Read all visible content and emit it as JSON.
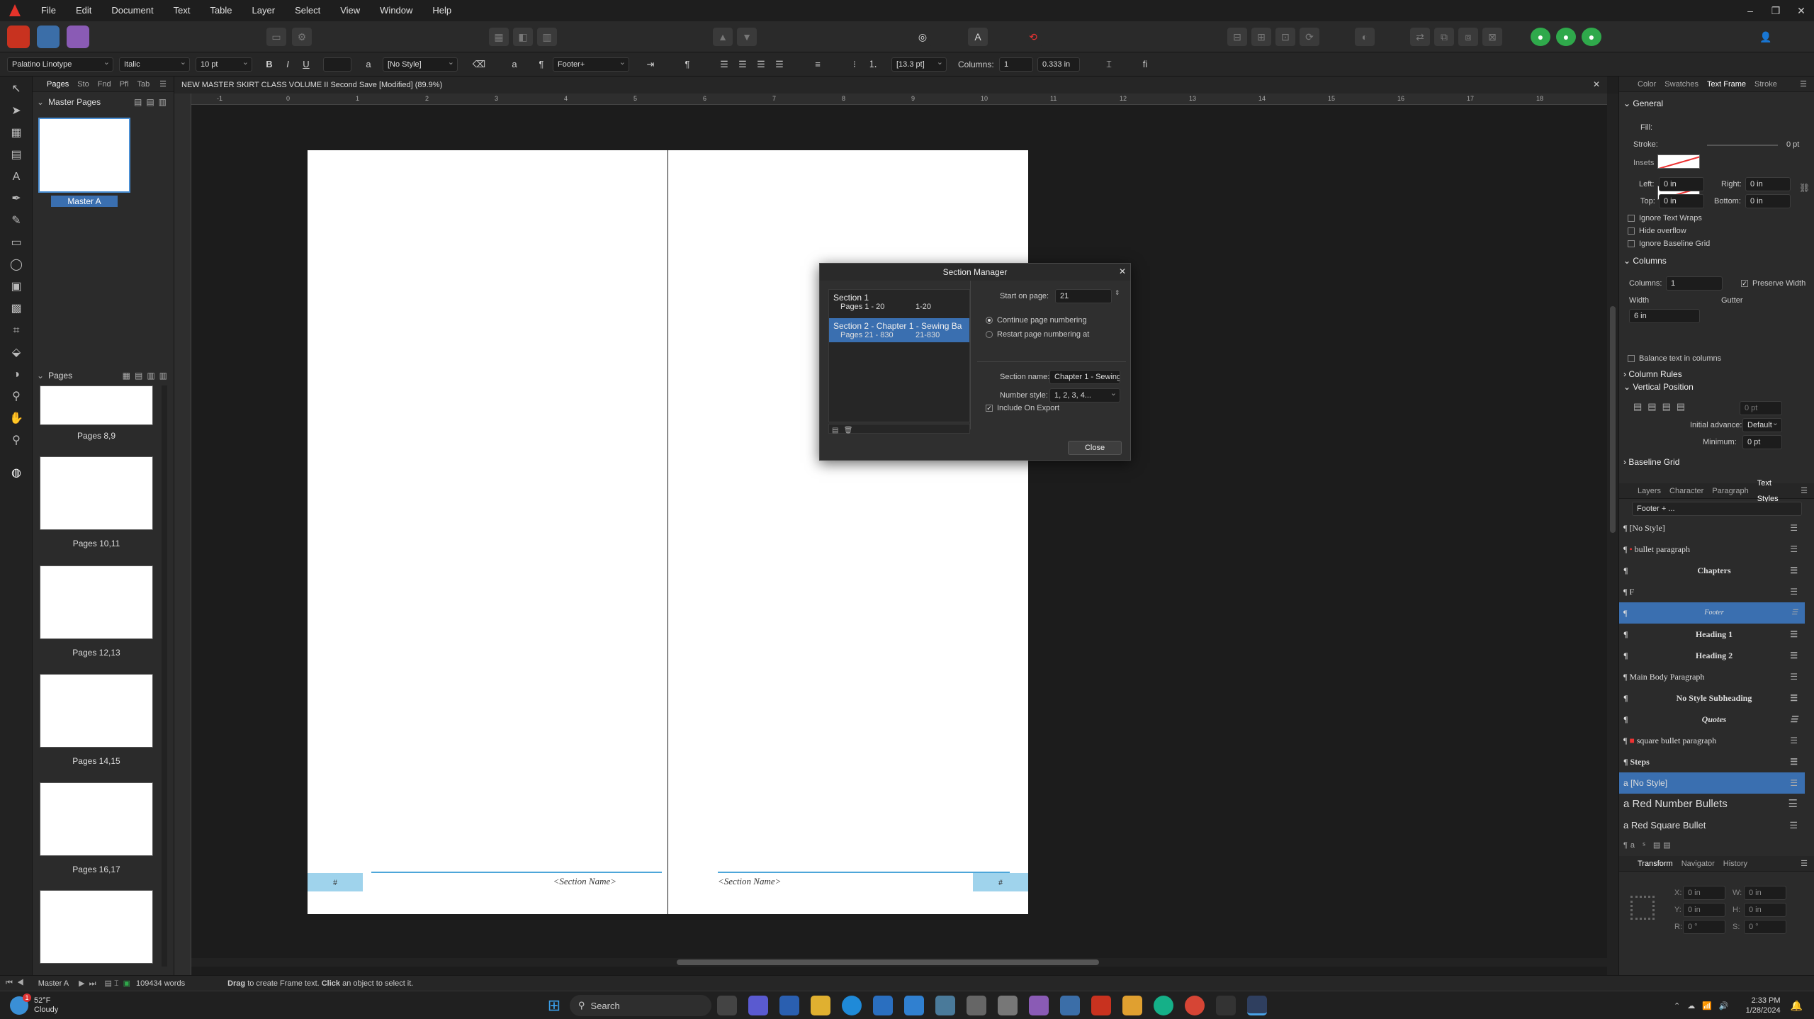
{
  "menu": [
    "File",
    "Edit",
    "Document",
    "Text",
    "Table",
    "Layer",
    "Select",
    "View",
    "Window",
    "Help"
  ],
  "context": {
    "font": "Palatino Linotype",
    "weight": "Italic",
    "size": "10 pt",
    "char_style": "[No Style]",
    "para_style": "Footer+",
    "leading": "[13.3 pt]",
    "columns_label": "Columns:",
    "columns": "1",
    "gutter": "0.333 in"
  },
  "left_tabs": [
    "Pages",
    "Sto",
    "Fnd",
    "Pfl",
    "Tab"
  ],
  "master": {
    "header": "Master Pages",
    "item": "Master A"
  },
  "pages": {
    "header": "Pages",
    "items": [
      "Pages 8,9",
      "Pages 10,11",
      "Pages 12,13",
      "Pages 14,15",
      "Pages 16,17"
    ]
  },
  "document": {
    "title": "NEW MASTER SKIRT CLASS VOLUME II Second Save [Modified] (89.9%)",
    "hash": "#",
    "section_name": "<Section Name>"
  },
  "ruler": [
    "-1",
    "0",
    "1",
    "2",
    "3",
    "4",
    "5",
    "6",
    "7",
    "8",
    "9",
    "10",
    "11",
    "12",
    "13",
    "14",
    "15",
    "16",
    "17",
    "18"
  ],
  "dialog": {
    "title": "Section Manager",
    "sections": [
      {
        "name": "Section 1",
        "pages": "Pages 1 - 20",
        "range": "1-20"
      },
      {
        "name": "Section 2 - Chapter 1 - Sewing Ba",
        "pages": "Pages 21 - 830",
        "range": "21-830"
      }
    ],
    "start_label": "Start on page:",
    "start": "21",
    "continue": "Continue page numbering",
    "restart": "Restart page numbering at",
    "name_label": "Section name:",
    "name": "Chapter 1 - Sewing",
    "style_label": "Number style:",
    "style": "1, 2, 3, 4...",
    "include": "Include On Export",
    "close": "Close"
  },
  "right_tabs": [
    "Color",
    "Swatches",
    "Text Frame",
    "Stroke"
  ],
  "textframe": {
    "general": "General",
    "fill": "Fill:",
    "stroke": "Stroke:",
    "stroke_val": "0 pt",
    "insets": "Insets",
    "left": "Left:",
    "left_v": "0 in",
    "right": "Right:",
    "right_v": "0 in",
    "top": "Top:",
    "top_v": "0 in",
    "bottom": "Bottom:",
    "bottom_v": "0 in",
    "ignore_wraps": "Ignore Text Wraps",
    "hide_overflow": "Hide overflow",
    "ignore_grid": "Ignore Baseline Grid",
    "columns_hdr": "Columns",
    "columns_lbl": "Columns:",
    "columns_v": "1",
    "preserve": "Preserve Width",
    "width": "Width",
    "gutter": "Gutter",
    "width_v": "6 in",
    "balance": "Balance text in columns",
    "col_rules": "Column Rules",
    "vpos": "Vertical Position",
    "vpos_v": "0 pt",
    "initial": "Initial advance:",
    "initial_v": "Default",
    "minimum": "Minimum:",
    "minimum_v": "0 pt",
    "baseline": "Baseline Grid"
  },
  "style_tabs": [
    "Layers",
    "Character",
    "Paragraph",
    "Text Styles"
  ],
  "styles_header": "Footer + ...",
  "styles": [
    "[No Style]",
    "bullet paragraph",
    "Chapters",
    "F",
    "Footer",
    "Heading 1",
    "Heading 2",
    "Main Body Paragraph",
    "No Style Subheading",
    "Quotes",
    "square bullet paragraph",
    "Steps",
    "[No Style]",
    "Red Number Bullets",
    "Red Square Bullet"
  ],
  "transform_tabs": [
    "Transform",
    "Navigator",
    "History"
  ],
  "transform": {
    "x": "X:",
    "x_v": "0 in",
    "y": "Y:",
    "y_v": "0 in",
    "w": "W:",
    "w_v": "0 in",
    "h": "H:",
    "h_v": "0 in",
    "r": "R:",
    "r_v": "0 °",
    "s": "S:",
    "s_v": "0 °"
  },
  "status": {
    "master": "Master A",
    "words": "109434 words",
    "hint_b": "Drag",
    "hint1": " to create Frame text. ",
    "hint_b2": "Click",
    "hint2": " an object to select it."
  },
  "taskbar": {
    "temp": "52°F",
    "weather": "Cloudy",
    "search": "Search",
    "time": "2:33 PM",
    "date": "1/28/2024",
    "badge": "1"
  }
}
